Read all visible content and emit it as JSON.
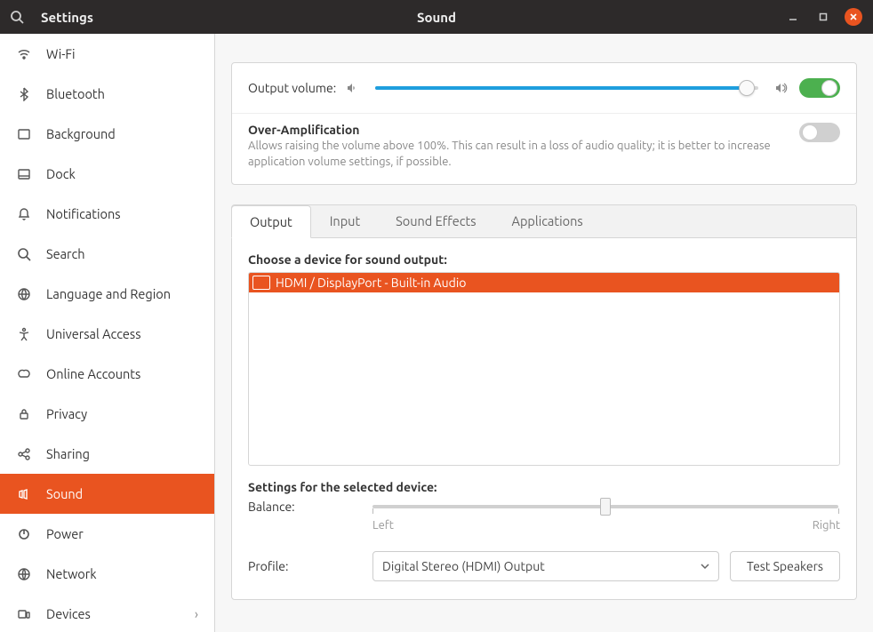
{
  "header": {
    "app_title": "Settings",
    "page_title": "Sound"
  },
  "sidebar": {
    "items": [
      {
        "id": "wifi",
        "label": "Wi-Fi"
      },
      {
        "id": "bluetooth",
        "label": "Bluetooth"
      },
      {
        "id": "background",
        "label": "Background"
      },
      {
        "id": "dock",
        "label": "Dock"
      },
      {
        "id": "notifications",
        "label": "Notifications"
      },
      {
        "id": "search",
        "label": "Search"
      },
      {
        "id": "language",
        "label": "Language and Region"
      },
      {
        "id": "universal",
        "label": "Universal Access"
      },
      {
        "id": "online",
        "label": "Online Accounts"
      },
      {
        "id": "privacy",
        "label": "Privacy"
      },
      {
        "id": "sharing",
        "label": "Sharing"
      },
      {
        "id": "sound",
        "label": "Sound"
      },
      {
        "id": "power",
        "label": "Power"
      },
      {
        "id": "network",
        "label": "Network"
      },
      {
        "id": "devices",
        "label": "Devices"
      }
    ],
    "active": "sound"
  },
  "volume": {
    "label": "Output volume:",
    "percent": 97,
    "muted_toggle_on": true
  },
  "overamp": {
    "title": "Over-Amplification",
    "desc": "Allows raising the volume above 100%. This can result in a loss of audio quality; it is better to increase application volume settings, if possible.",
    "enabled": false
  },
  "tabs": {
    "items": [
      "Output",
      "Input",
      "Sound Effects",
      "Applications"
    ],
    "active": 0
  },
  "output": {
    "choose_label": "Choose a device for sound output:",
    "devices": [
      "HDMI / DisplayPort - Built-in Audio"
    ],
    "selected_device": 0,
    "settings_label": "Settings for the selected device:",
    "balance_label": "Balance:",
    "balance_left": "Left",
    "balance_right": "Right",
    "balance_value": 0.5,
    "profile_label": "Profile:",
    "profile_value": "Digital Stereo (HDMI) Output",
    "test_button": "Test Speakers"
  },
  "colors": {
    "accent": "#e95420",
    "slider": "#1f9ede",
    "toggle_on": "#4cb04f"
  }
}
